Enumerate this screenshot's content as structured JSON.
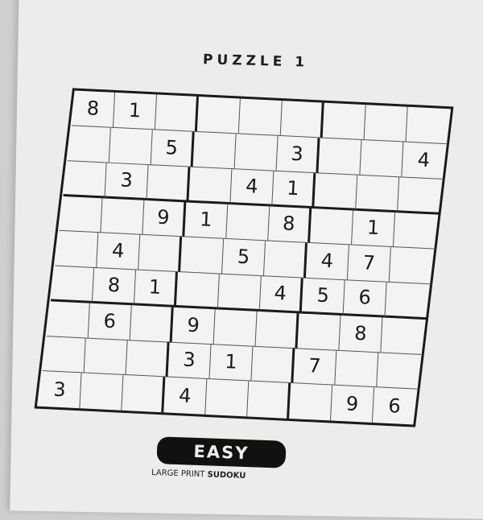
{
  "title": "PUZZLE 1",
  "difficulty": "EASY",
  "footer": {
    "prefix": "LARGE PRINT",
    "brand": "SUDOKU"
  },
  "grid": [
    [
      "8",
      "1",
      "",
      "",
      "",
      "",
      "",
      "",
      ""
    ],
    [
      "",
      "",
      "5",
      "",
      "",
      "3",
      "",
      "",
      "4"
    ],
    [
      "",
      "3",
      "",
      "",
      "4",
      "1",
      "",
      "",
      ""
    ],
    [
      "",
      "",
      "9",
      "1",
      "",
      "8",
      "",
      "1",
      ""
    ],
    [
      "",
      "4",
      "",
      "",
      "5",
      "",
      "4",
      "7",
      ""
    ],
    [
      "",
      "8",
      "1",
      "",
      "",
      "4",
      "5",
      "6",
      ""
    ],
    [
      "",
      "6",
      "",
      "9",
      "",
      "",
      "",
      "8",
      ""
    ],
    [
      "",
      "",
      "",
      "3",
      "1",
      "",
      "7",
      "",
      ""
    ],
    [
      "3",
      "",
      "",
      "4",
      "",
      "",
      "",
      "9",
      "6"
    ]
  ]
}
